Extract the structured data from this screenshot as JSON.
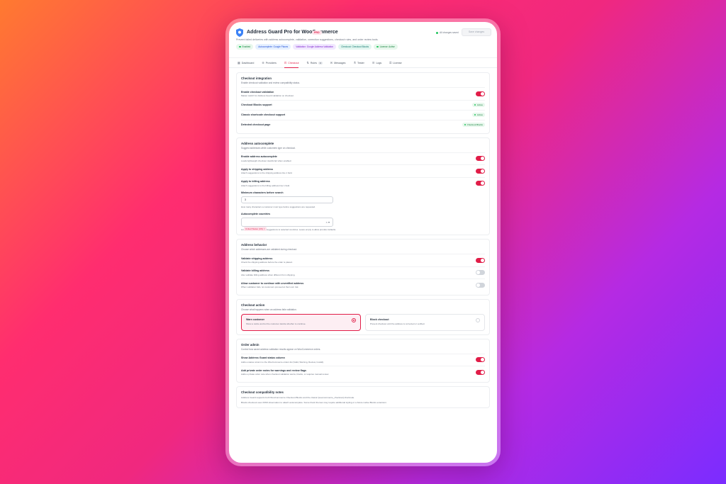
{
  "header": {
    "title": "Address Guard Pro for WooCommerce",
    "badge": "PRO",
    "subtitle": "Prevent failed deliveries with address autocomplete, validation, correction suggestions, checkout rules, and order review tools.",
    "saved_text": "All changes saved",
    "save_label": "Save changes",
    "pills": [
      "Enabled",
      "Autocomplete: Google Places",
      "Validation: Google Address Validation",
      "Checkout: Checkout Blocks",
      "License: Active"
    ]
  },
  "tabs": [
    "Dashboard",
    "Providers",
    "Checkout",
    "Rules",
    "Messages",
    "Tester",
    "Logs",
    "License"
  ],
  "rules_count": "3",
  "checkout_integration": {
    "title": "Checkout integration",
    "desc": "Enable checkout validation and review compatibility status.",
    "enable_label": "Enable checkout validation",
    "enable_desc": "Master switch for Address Guard validation on checkout.",
    "blocks_label": "Checkout Blocks support",
    "blocks_status": "Active",
    "classic_label": "Classic shortcode checkout support",
    "classic_status": "Active",
    "page_label": "Detected checkout page",
    "page_status": "Checkout Blocks"
  },
  "autocomplete": {
    "title": "Address autocomplete",
    "desc": "Suggest addresses while customers type on checkout.",
    "enable_label": "Enable address autocomplete",
    "enable_desc": "Loads lightweight checkout JavaScript when enabled.",
    "shipping_label": "Apply to shipping address",
    "shipping_desc": "Attach suggestions to the shipping address line 1 field.",
    "billing_label": "Apply to billing address",
    "billing_desc": "Attach suggestions to the billing address line 1 field.",
    "min_label": "Minimum characters before search",
    "min_value": "3",
    "min_help": "How many characters a customer must type before suggestions are requested.",
    "countries_label": "Autocomplete countries",
    "countries_chip": "United States (US)",
    "countries_help": "Limit or bias autocomplete suggestions to selected countries. Leave empty to allow provider defaults."
  },
  "behavior": {
    "title": "Address behavior",
    "desc": "Choose which addresses are validated during checkout.",
    "ship_label": "Validate shipping address",
    "ship_desc": "Check the shipping address before the order is placed.",
    "bill_label": "Validate billing address",
    "bill_desc": "Also validate billing address when different from shipping.",
    "unverified_label": "Allow customer to continue with unverified address",
    "unverified_desc": "When validation fails, let customers proceed at their own risk."
  },
  "action": {
    "title": "Checkout action",
    "desc": "Choose what happens when an address fails validation.",
    "warn_label": "Warn customer",
    "warn_desc": "Show a notice and let the customer decide whether to continue.",
    "block_label": "Block checkout",
    "block_desc": "Prevent checkout until the address is corrected or verified."
  },
  "order_admin": {
    "title": "Order admin",
    "desc": "Control how saved address validation results appear on WooCommerce orders.",
    "col_label": "Show Address Guard status column",
    "col_desc": "Adds a status column to the WooCommerce orders list (Valid, Warning, Review, Invalid).",
    "notes_label": "Add private order notes for warnings and review flags",
    "notes_desc": "Adds a private order note when checkout validation warns, blocks, or requires manual review."
  },
  "compat": {
    "title": "Checkout compatibility notes",
    "p1": "Address Guard supports both WooCommerce Checkout Blocks and the classic [woocommerce_checkout] shortcode.",
    "p2": "Blocks checkout uses DOM observation to attach autocomplete. Some block themes may require additional styling or a future native Blocks extension."
  },
  "colors": {
    "accent": "#e11d48",
    "success": "#22c55e"
  }
}
